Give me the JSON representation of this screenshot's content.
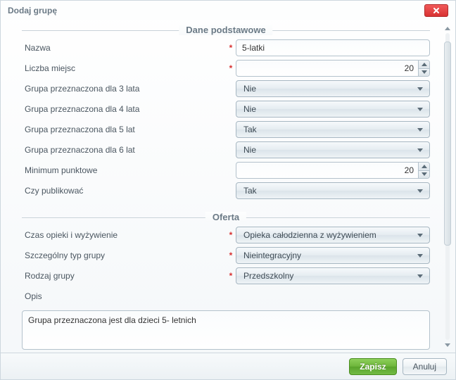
{
  "dialog": {
    "title": "Dodaj grupę"
  },
  "sections": {
    "basic": {
      "legend": "Dane podstawowe",
      "fields": {
        "name": {
          "label": "Nazwa",
          "value": "5-latki"
        },
        "seats": {
          "label": "Liczba miejsc",
          "value": "20"
        },
        "age3": {
          "label": "Grupa przeznaczona dla 3 lata",
          "value": "Nie"
        },
        "age4": {
          "label": "Grupa przeznaczona dla 4 lata",
          "value": "Nie"
        },
        "age5": {
          "label": "Grupa przeznaczona dla 5 lat",
          "value": "Tak"
        },
        "age6": {
          "label": "Grupa przeznaczona dla 6 lat",
          "value": "Nie"
        },
        "minpts": {
          "label": "Minimum punktowe",
          "value": "20"
        },
        "publish": {
          "label": "Czy publikować",
          "value": "Tak"
        }
      }
    },
    "offer": {
      "legend": "Oferta",
      "fields": {
        "care": {
          "label": "Czas opieki i wyżywienie",
          "value": "Opieka całodzienna z wyżywieniem"
        },
        "gtype": {
          "label": "Szczególny typ grupy",
          "value": "Nieintegracyjny"
        },
        "kind": {
          "label": "Rodzaj grupy",
          "value": "Przedszkolny"
        },
        "desc": {
          "label": "Opis",
          "value": "Grupa przeznaczona jest dla dzieci 5- letnich"
        }
      }
    }
  },
  "buttons": {
    "save": "Zapisz",
    "cancel": "Anuluj"
  }
}
